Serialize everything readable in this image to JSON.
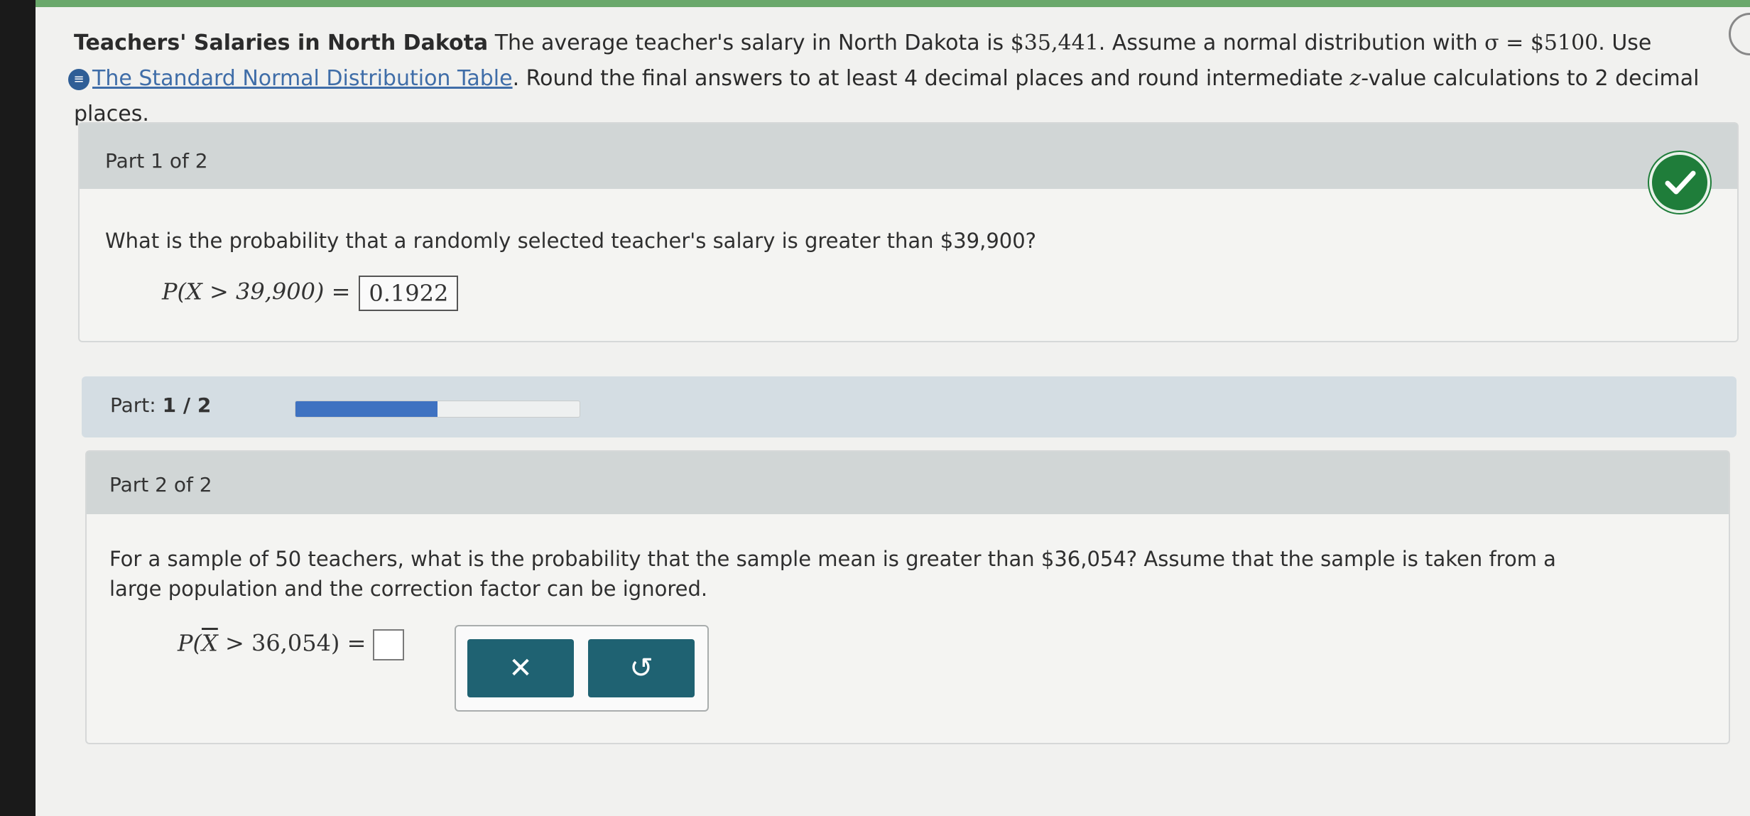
{
  "question": {
    "title": "Teachers' Salaries in North Dakota",
    "text_1": " The average teacher's salary in North Dakota is ",
    "mean_value": "$35,441",
    "text_2": ". Assume a normal distribution with ",
    "sigma_value": "σ = $5100",
    "text_3": ". Use",
    "table_link": "The Standard Normal Distribution Table",
    "text_4": ". Round the final answers to at least 4 decimal places and round intermediate ",
    "z_var": "z",
    "text_5": "-value calculations to 2 decimal places."
  },
  "part1": {
    "header": "Part 1 of 2",
    "status_icon": "check-icon",
    "question": "What is the probability that a randomly selected teacher's salary is greater than $39,900?",
    "expression": "P(X > 39,900) =",
    "answer": "0.1922"
  },
  "progress": {
    "label": "Part:",
    "value": "1 / 2",
    "fraction": 0.5,
    "fill_color": "#3f72c1"
  },
  "part2": {
    "header": "Part 2 of 2",
    "question": "For a sample of 50 teachers, what is the probability that the sample mean is greater than $36,054? Assume that the sample is taken from a large population and the correction factor can be ignored.",
    "expression_prefix": "P(",
    "expression_var": "X",
    "expression_suffix": " > 36,054) =",
    "answer": ""
  },
  "tools": {
    "clear_symbol": "✕",
    "undo_symbol": "↺"
  },
  "colors": {
    "check_green": "#1f7d3a",
    "button_teal": "#1f6272",
    "link_blue": "#3f6da8"
  }
}
